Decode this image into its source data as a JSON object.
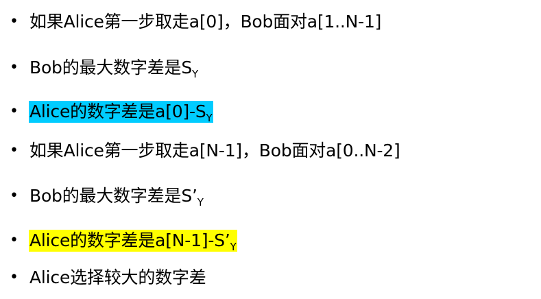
{
  "bullets": [
    {
      "symbol": "•",
      "text": "如果Alice第一步取走a[0]，Bob面对a[1..N-1]",
      "sub": ""
    },
    {
      "symbol": "•",
      "text": "Bob的最大数字差是S",
      "sub": "Y"
    },
    {
      "symbol": "•",
      "text": "Alice的数字差是a[0]-S",
      "sub": "Y",
      "highlight": "#00ccff"
    },
    {
      "symbol": "•",
      "text": "如果Alice第一步取走a[N-1]，Bob面对a[0..N-2]",
      "sub": ""
    },
    {
      "symbol": "•",
      "text": "Bob的最大数字差是S’",
      "sub": "Y"
    },
    {
      "symbol": "•",
      "text": "Alice的数字差是a[N-1]-S’",
      "sub": "Y",
      "highlight": "#ffff00"
    },
    {
      "symbol": "•",
      "text": "Alice选择较大的数字差",
      "sub": ""
    }
  ]
}
